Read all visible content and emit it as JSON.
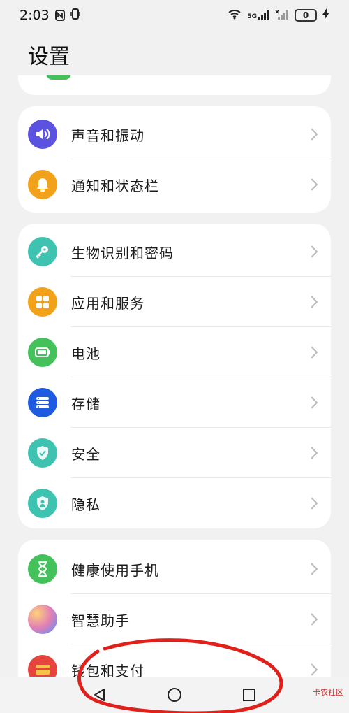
{
  "status_bar": {
    "time": "2:03",
    "battery": "0",
    "network": "5G"
  },
  "header": {
    "title": "设置"
  },
  "groups": [
    {
      "items": [
        {
          "label": "声音和振动",
          "icon": "speaker-icon",
          "color": "#5b52e0"
        },
        {
          "label": "通知和状态栏",
          "icon": "bell-icon",
          "color": "#f2a21a"
        }
      ]
    },
    {
      "items": [
        {
          "label": "生物识别和密码",
          "icon": "key-icon",
          "color": "#3ec3b1"
        },
        {
          "label": "应用和服务",
          "icon": "apps-grid-icon",
          "color": "#f2a21a"
        },
        {
          "label": "电池",
          "icon": "battery-icon",
          "color": "#45c15b"
        },
        {
          "label": "存储",
          "icon": "storage-icon",
          "color": "#1f5be0"
        },
        {
          "label": "安全",
          "icon": "shield-check-icon",
          "color": "#3ec3b1"
        },
        {
          "label": "隐私",
          "icon": "privacy-shield-icon",
          "color": "#3ec3b1"
        }
      ]
    },
    {
      "items": [
        {
          "label": "健康使用手机",
          "icon": "hourglass-icon",
          "color": "#45c15b"
        },
        {
          "label": "智慧助手",
          "icon": "assistant-icon",
          "color": "#e07fb6"
        },
        {
          "label": "钱包和支付",
          "icon": "wallet-icon",
          "color": "#e5453c"
        }
      ]
    }
  ],
  "nav": {
    "back": "back-icon",
    "home": "home-icon",
    "recents": "recents-icon"
  },
  "watermark": {
    "text": "卡农社区"
  }
}
